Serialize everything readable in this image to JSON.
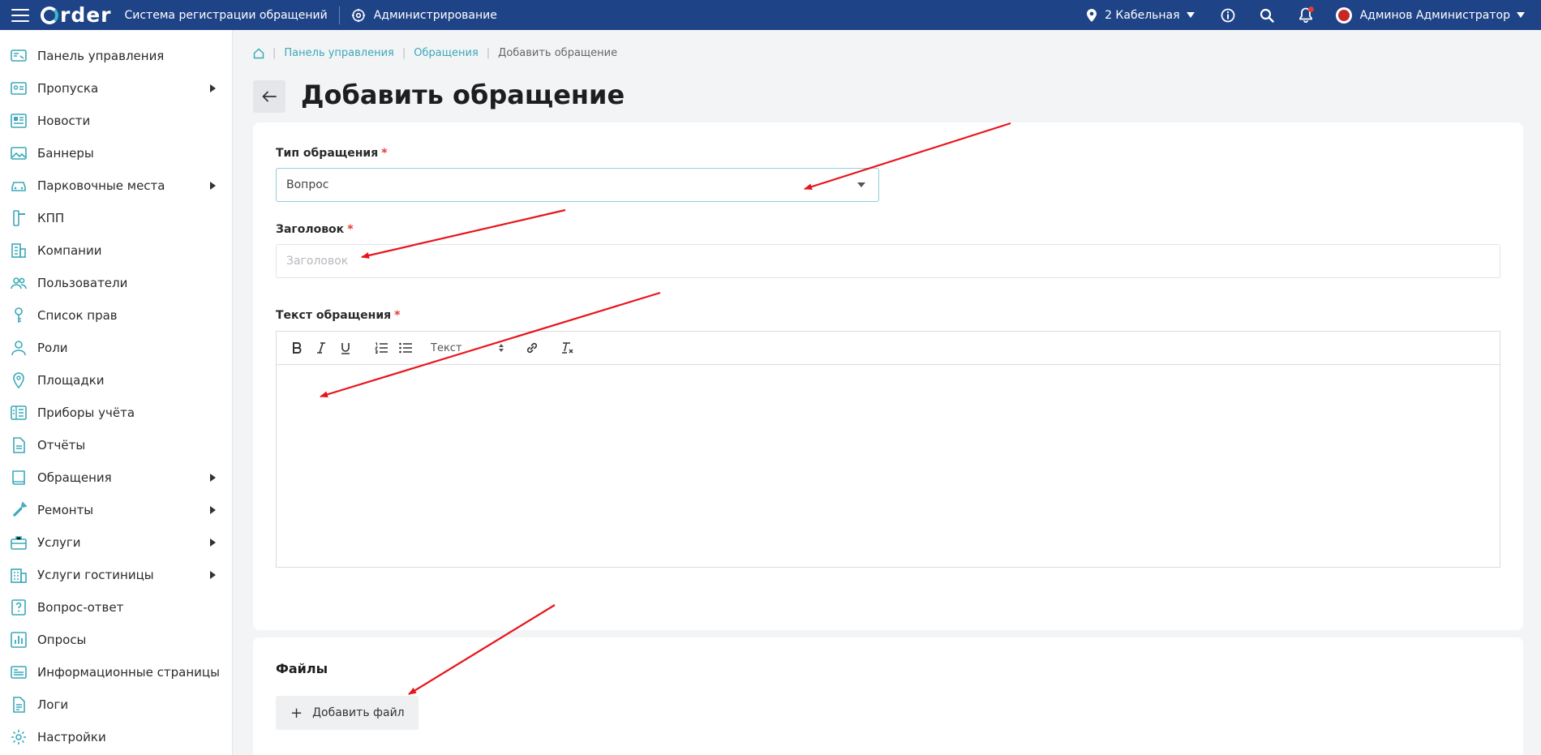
{
  "topbar": {
    "logo_text": "rder",
    "system_title": "Система регистрации обращений",
    "admin_label": "Администрирование",
    "location": "2 Кабельная",
    "user_name": "Админов Администратор"
  },
  "sidebar": {
    "items": [
      {
        "label": "Панель управления",
        "icon": "dashboard-icon",
        "has_submenu": false
      },
      {
        "label": "Пропуска",
        "icon": "pass-card-icon",
        "has_submenu": true
      },
      {
        "label": "Новости",
        "icon": "news-icon",
        "has_submenu": false
      },
      {
        "label": "Баннеры",
        "icon": "image-icon",
        "has_submenu": false
      },
      {
        "label": "Парковочные места",
        "icon": "car-icon",
        "has_submenu": true
      },
      {
        "label": "КПП",
        "icon": "checkpoint-icon",
        "has_submenu": false
      },
      {
        "label": "Компании",
        "icon": "building-icon",
        "has_submenu": false
      },
      {
        "label": "Пользователи",
        "icon": "users-icon",
        "has_submenu": false
      },
      {
        "label": "Список прав",
        "icon": "key-icon",
        "has_submenu": false
      },
      {
        "label": "Роли",
        "icon": "user-icon",
        "has_submenu": false
      },
      {
        "label": "Площадки",
        "icon": "map-pin-icon",
        "has_submenu": false
      },
      {
        "label": "Приборы учёта",
        "icon": "meter-icon",
        "has_submenu": false
      },
      {
        "label": "Отчёты",
        "icon": "document-icon",
        "has_submenu": false
      },
      {
        "label": "Обращения",
        "icon": "book-icon",
        "has_submenu": true
      },
      {
        "label": "Ремонты",
        "icon": "wrench-icon",
        "has_submenu": true
      },
      {
        "label": "Услуги",
        "icon": "briefcase-icon",
        "has_submenu": true
      },
      {
        "label": "Услуги гостиницы",
        "icon": "hotel-icon",
        "has_submenu": true
      },
      {
        "label": "Вопрос-ответ",
        "icon": "question-icon",
        "has_submenu": false
      },
      {
        "label": "Опросы",
        "icon": "poll-chart-icon",
        "has_submenu": false
      },
      {
        "label": "Информационные страницы",
        "icon": "info-page-icon",
        "has_submenu": false
      },
      {
        "label": "Логи",
        "icon": "log-file-icon",
        "has_submenu": false
      },
      {
        "label": "Настройки",
        "icon": "gear-icon",
        "has_submenu": false
      }
    ]
  },
  "breadcrumb": {
    "items": [
      "Панель управления",
      "Обращения"
    ],
    "current": "Добавить обращение"
  },
  "page": {
    "title": "Добавить обращение"
  },
  "form": {
    "type_label": "Тип обращения",
    "type_value": "Вопрос",
    "subject_label": "Заголовок",
    "subject_placeholder": "Заголовок",
    "subject_value": "",
    "body_label": "Текст обращения",
    "required_mark": "*",
    "editor_style_value": "Текст"
  },
  "files": {
    "title": "Файлы",
    "add_label": "Добавить файл"
  },
  "colors": {
    "topbar_bg": "#1f4387",
    "accent": "#3aa9b9",
    "required": "#e53935",
    "annotation_arrow": "#e8141b"
  }
}
